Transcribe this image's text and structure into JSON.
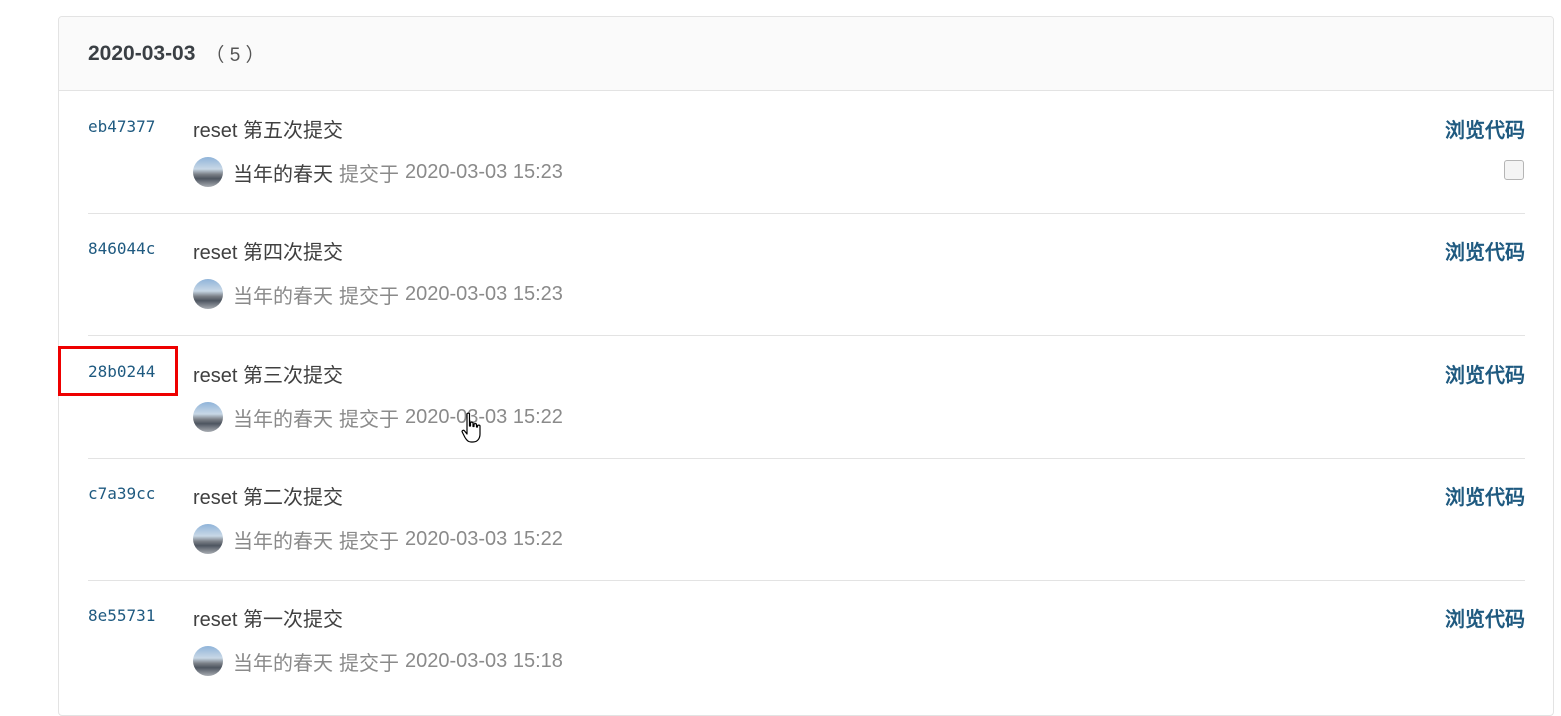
{
  "group": {
    "date": "2020-03-03",
    "count": "（ 5 ）"
  },
  "browse_label": "浏览代码",
  "committed_label": "提交于",
  "commits": [
    {
      "sha": "eb47377",
      "message": "reset 第五次提交",
      "author": "当年的春天",
      "time": "2020-03-03 15:23"
    },
    {
      "sha": "846044c",
      "message": "reset 第四次提交",
      "author": "当年的春天",
      "time": "2020-03-03 15:23"
    },
    {
      "sha": "28b0244",
      "message": "reset 第三次提交",
      "author": "当年的春天",
      "time": "2020-03-03 15:22"
    },
    {
      "sha": "c7a39cc",
      "message": "reset 第二次提交",
      "author": "当年的春天",
      "time": "2020-03-03 15:22"
    },
    {
      "sha": "8e55731",
      "message": "reset 第一次提交",
      "author": "当年的春天",
      "time": "2020-03-03 15:18"
    }
  ],
  "colors": {
    "link": "#1f5a80",
    "highlight": "#ee0000"
  }
}
